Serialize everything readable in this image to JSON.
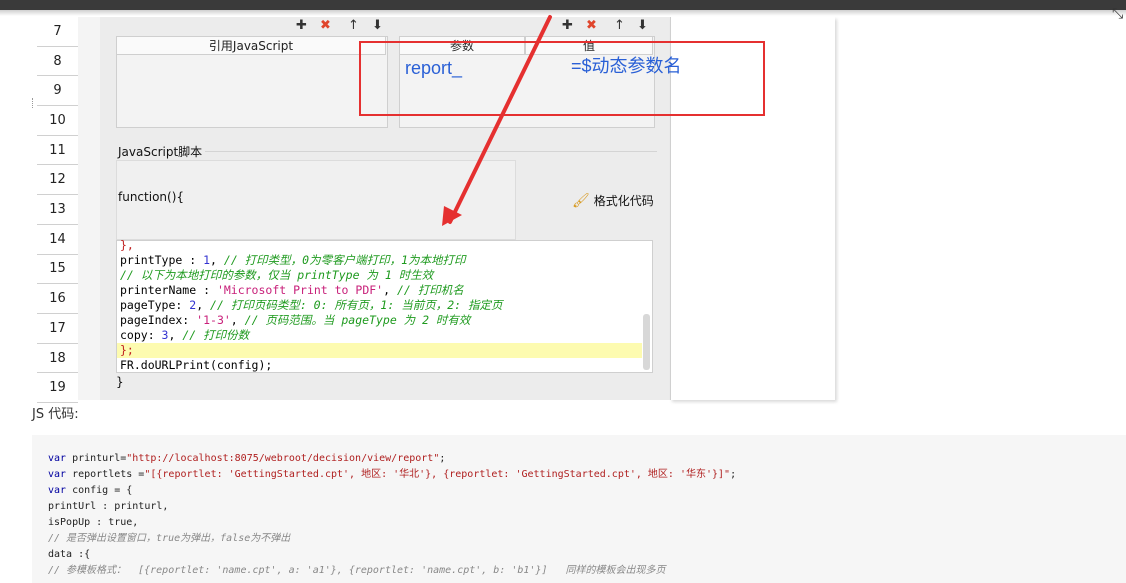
{
  "row_numbers": [
    "7",
    "8",
    "9",
    "10",
    "11",
    "12",
    "13",
    "14",
    "15",
    "16",
    "17",
    "18",
    "19"
  ],
  "dialog": {
    "left_header": "引用JavaScript",
    "param_header": "参数",
    "value_header": "值",
    "toolbar_icons": [
      "add-icon",
      "delete-icon",
      "move-up-icon",
      "move-down-icon"
    ],
    "script_section_label": "JavaScript脚本",
    "function_open": "function(){",
    "format_button": "格式化代码",
    "close_brace": "}"
  },
  "code_lines": [
    "},",
    "printType : 1, // 打印类型，0为零客户端打印，1为本地打印",
    "// 以下为本地打印的参数，仅当 printType 为 1 时生效",
    "printerName : 'Microsoft Print to PDF', // 打印机名",
    "pageType: 2, // 打印页码类型: 0: 所有页，1: 当前页，2: 指定页",
    "pageIndex: '1-3', // 页码范围。当 pageType 为 2 时有效",
    "copy: 3, // 打印份数",
    "};",
    "FR.doURLPrint(config);"
  ],
  "annotation": {
    "report_text": "report_",
    "dynamic_text": "=$动态参数名"
  },
  "js_section_label": "JS 代码:",
  "js_code": [
    "var printurl=\"http://localhost:8075/webroot/decision/view/report\";",
    "var reportlets =\"[{reportlet: 'GettingStarted.cpt', 地区: '华北'}, {reportlet: 'GettingStarted.cpt', 地区: '华东'}]\";",
    "var config = {",
    "printUrl : printurl,",
    "isPopUp : true,",
    "// 是否弹出设置窗口，true为弹出，false为不弹出",
    "data :{",
    "// 参模板格式：  [{reportlet: 'name.cpt', a: 'a1'}, {reportlet: 'name.cpt', b: 'b1'}]   同样的模板会出现多页"
  ],
  "colors": {
    "annotation_box": "#e53030",
    "annotation_text": "#2a60d6",
    "arrow": "#e53030",
    "code_comment": "#1e9a1e",
    "code_number": "#3232d0",
    "code_string": "#c8207a"
  }
}
